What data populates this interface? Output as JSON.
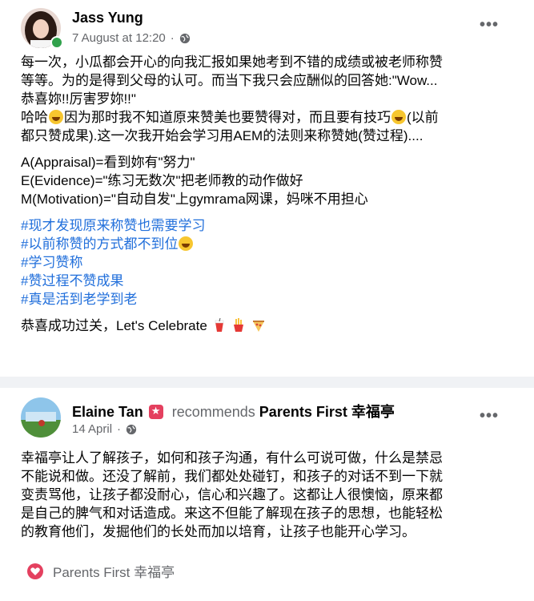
{
  "post1": {
    "author": "Jass Yung",
    "date": "7 August at 12:20",
    "more": "•••",
    "lines": [
      "每一次，小瓜都会开心的向我汇报如果她考到不错的成绩或被老师称赞",
      "等等。为的是得到父母的认可。而当下我只会应酬似的回答她:\"Wow...",
      "恭喜妳!!厉害罗妳!!\""
    ],
    "line4a": "哈哈",
    "line4b": "因为那时我不知道原来赞美也要赞得对，而且要有技巧",
    "line4c": "(以前",
    "line5": "都只赞成果).这一次我开始会学习用AEM的法则来称赞她(赞过程)....",
    "aem": [
      "A(Appraisal)=看到妳有\"努力\"",
      "E(Evidence)=\"练习无数次\"把老师教的动作做好",
      "M(Motivation)=\"自动自发\"上gymrama网课，妈咪不用担心"
    ],
    "tags": [
      "#现才发现原来称赞也需要学习",
      "#以前称赞的方式都不到位",
      "#学习赞称",
      "#赞过程不赞成果",
      "#真是活到老学到老"
    ],
    "closing": "恭喜成功过关，Let's Celebrate",
    "icons": [
      "smiling-face-emoji",
      "drink-emoji",
      "fries-emoji",
      "pizza-emoji",
      "globe-icon"
    ]
  },
  "post2": {
    "author": "Elaine Tan",
    "recommends": "recommends",
    "page": "Parents First 幸福亭",
    "date": "14 April",
    "more": "•••",
    "lines": [
      "幸福亭让人了解孩子，如何和孩子沟通，有什么可说可做，什么是禁忌",
      "不能说和做。还没了解前，我们都处处碰钉，和孩子的对话不到一下就",
      "变责骂他，让孩子都没耐心，信心和兴趣了。这都让人很懊恼，原来都",
      "是自己的脾气和对话造成。来这不但能了解现在孩子的思想，也能轻松",
      "的教育他们，发掘他们的长处而加以培育，让孩子也能开心学习。"
    ],
    "footer_page": "Parents First 幸福亭",
    "icons": [
      "star-badge-icon",
      "globe-icon",
      "heart-icon"
    ]
  },
  "colors": {
    "hashtag": "#216fdb",
    "meta": "#65676b",
    "online": "#31a24c",
    "heart": "#e4405f"
  }
}
